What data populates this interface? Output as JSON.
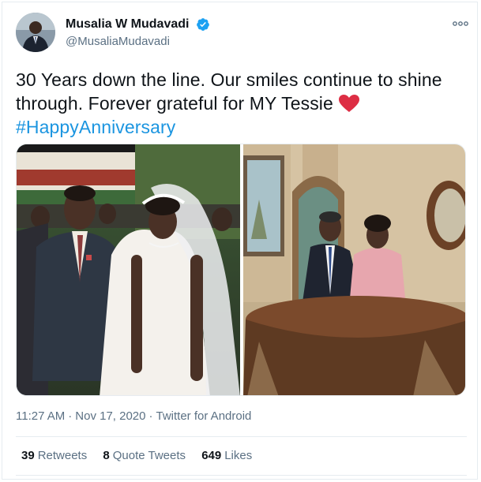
{
  "user": {
    "display_name": "Musalia W Mudavadi",
    "handle": "@MusaliaMudavadi",
    "verified": true,
    "avatar_icon": "profile-photo"
  },
  "tweet": {
    "text_line1": "30 Years down the line. Our smiles continue to shine",
    "text_line2": "through. Forever grateful for MY Tessie",
    "emoji": "red-heart",
    "hashtag": "#HappyAnniversary"
  },
  "media": {
    "photos": [
      {
        "label": "wedding-photo"
      },
      {
        "label": "anniversary-photo"
      }
    ]
  },
  "meta": {
    "time": "11:27 AM",
    "separator": "·",
    "date": "Nov 17, 2020",
    "source": "Twitter for Android"
  },
  "stats": {
    "retweets_count": "39",
    "retweets_label": "Retweets",
    "quotes_count": "8",
    "quotes_label": "Quote Tweets",
    "likes_count": "649",
    "likes_label": "Likes"
  },
  "colors": {
    "link": "#1b95e0",
    "secondary_text": "#5b7083",
    "verified_badge": "#1da1f2",
    "heart": "#e0245e",
    "border": "#e6ecf0"
  }
}
